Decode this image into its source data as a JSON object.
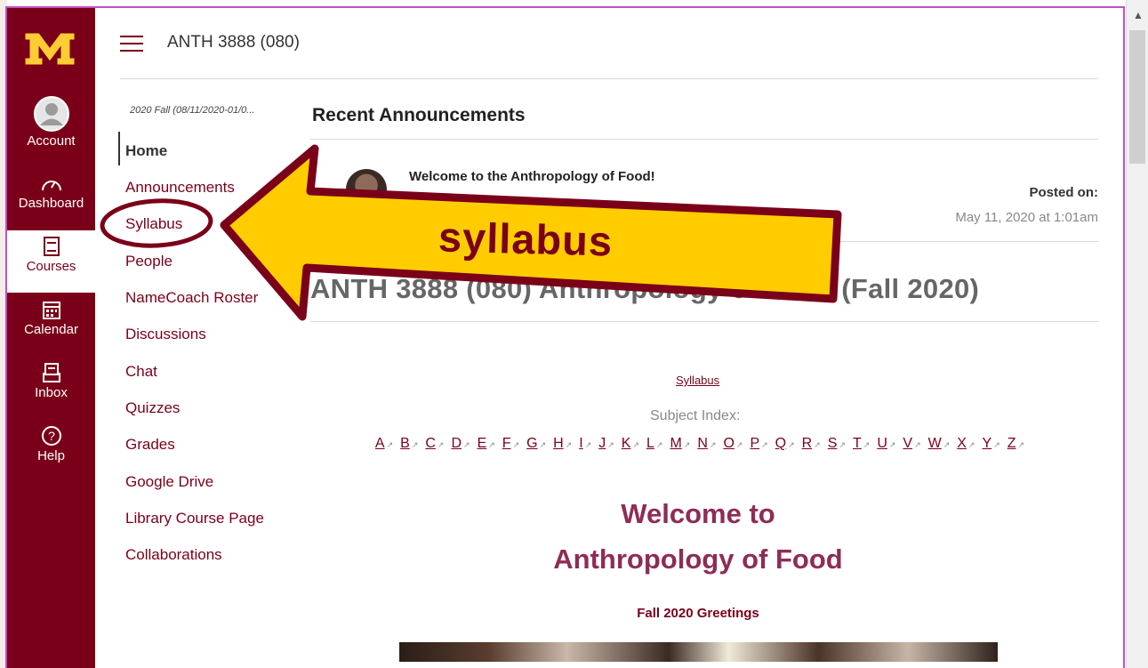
{
  "global_nav": {
    "items": [
      {
        "label": "Account",
        "icon": "account-avatar-icon"
      },
      {
        "label": "Dashboard",
        "icon": "dashboard-icon"
      },
      {
        "label": "Courses",
        "icon": "courses-icon"
      },
      {
        "label": "Calendar",
        "icon": "calendar-icon"
      },
      {
        "label": "Inbox",
        "icon": "inbox-icon"
      },
      {
        "label": "Help",
        "icon": "help-icon"
      }
    ],
    "active": "Courses",
    "brand_color": "#7a0019",
    "logo_color": "#ffcc33"
  },
  "header": {
    "course_code": "ANTH 3888 (080)"
  },
  "course_nav": {
    "term": "2020 Fall (08/11/2020-01/0...",
    "items": [
      "Home",
      "Announcements",
      "Syllabus",
      "People",
      "NameCoach Roster",
      "Discussions",
      "Chat",
      "Quizzes",
      "Grades",
      "Google Drive",
      "Library Course Page",
      "Collaborations"
    ],
    "active": "Home"
  },
  "recent_announcements": {
    "heading": "Recent Announcements",
    "title": "Welcome to the Anthropology of Food!",
    "posted_label": "Posted on:",
    "posted_date": "May 11, 2020 at 1:01am"
  },
  "page": {
    "course_title": "ANTH 3888 (080) Anthropology of Food (Fall 2020)",
    "syllabus_link": "Syllabus",
    "subject_index_label": "Subject Index:",
    "subject_letters": [
      "A",
      "B",
      "C",
      "D",
      "E",
      "F",
      "G",
      "H",
      "I",
      "J",
      "K",
      "L",
      "M",
      "N",
      "O",
      "P",
      "Q",
      "R",
      "S",
      "T",
      "U",
      "V",
      "W",
      "X",
      "Y",
      "Z"
    ],
    "welcome_line1": "Welcome to",
    "welcome_line2": "Anthropology of Food",
    "greetings": "Fall 2020 Greetings"
  },
  "annotation": {
    "callout_text": "syllabus",
    "arrow_fill": "#ffcc00",
    "arrow_stroke": "#7a0019"
  }
}
